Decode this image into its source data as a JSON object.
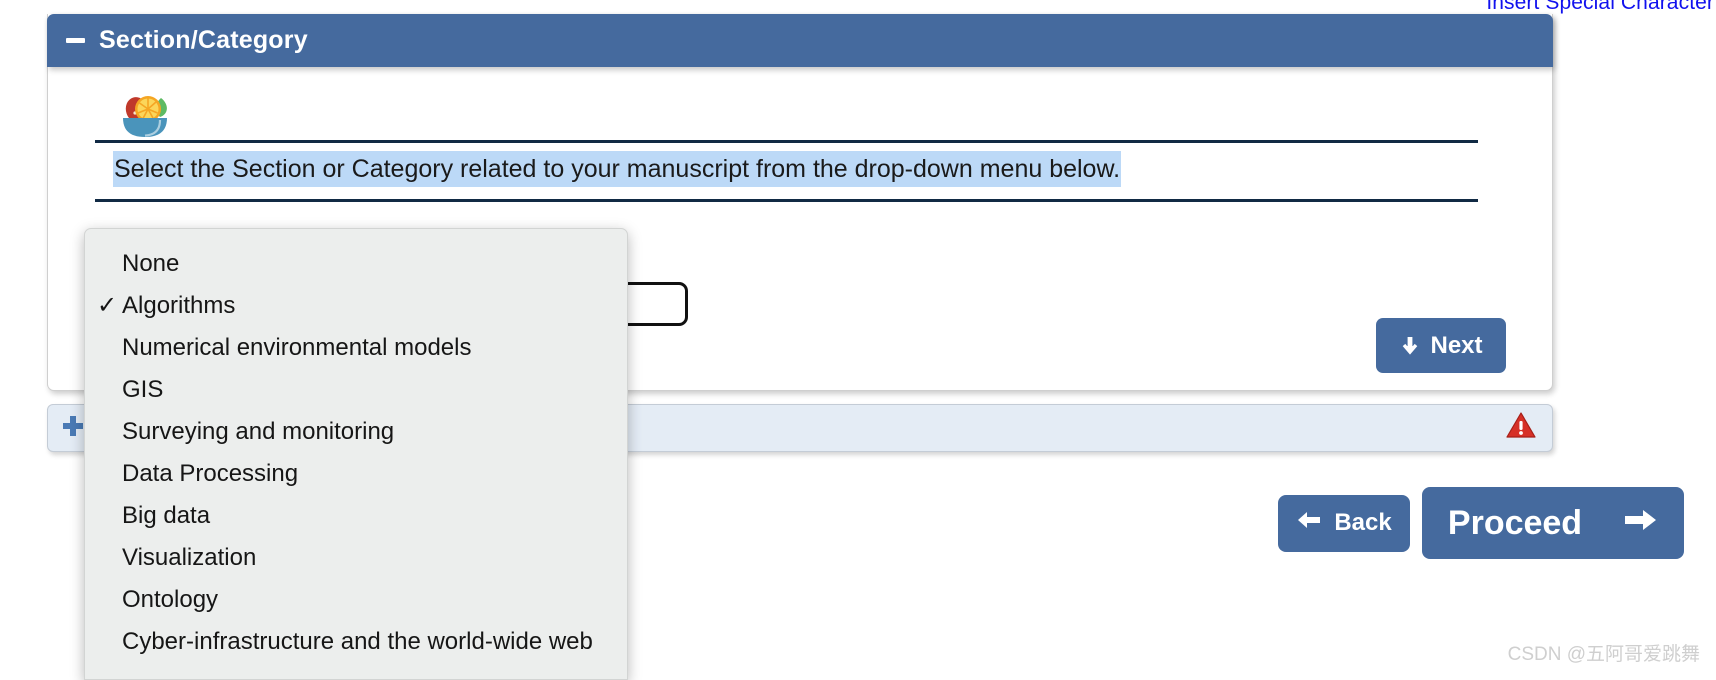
{
  "top_link": {
    "label": "Insert Special Character",
    "color": "#1111ee"
  },
  "panel": {
    "title": "Section/Category",
    "collapse_icon": "minus-icon",
    "header_color": "#456a9e",
    "instruction": "Select the Section or Category related to your manuscript from the drop-down menu below.",
    "instruction_highlight_color": "#bcd9f7",
    "decor_icon": "salad-bowl-icon",
    "next_button": {
      "label": "Next",
      "icon": "arrow-down-icon"
    }
  },
  "dropdown": {
    "selected": "Algorithms",
    "check_glyph": "✓",
    "background": "#eceeed",
    "items": [
      {
        "label": "None",
        "checked": false
      },
      {
        "label": "Algorithms",
        "checked": true
      },
      {
        "label": "Numerical environmental models",
        "checked": false
      },
      {
        "label": "GIS",
        "checked": false
      },
      {
        "label": "Surveying and monitoring",
        "checked": false
      },
      {
        "label": "Data Processing",
        "checked": false
      },
      {
        "label": "Big data",
        "checked": false
      },
      {
        "label": "Visualization",
        "checked": false
      },
      {
        "label": "Ontology",
        "checked": false
      },
      {
        "label": "Cyber-infrastructure and the world-wide web",
        "checked": false
      }
    ]
  },
  "collapsed_section": {
    "expand_icon": "plus-icon",
    "expand_icon_color": "#4a7ab5",
    "warning_icon": "warning-triangle-icon",
    "warning_icon_color": "#d63027",
    "background": "#e4ecf5"
  },
  "footer": {
    "back_button": {
      "label": "Back",
      "icon": "arrow-left-icon"
    },
    "proceed_button": {
      "label": "Proceed",
      "icon": "arrow-right-icon"
    }
  },
  "watermark": {
    "text": "CSDN @五阿哥爱跳舞"
  }
}
